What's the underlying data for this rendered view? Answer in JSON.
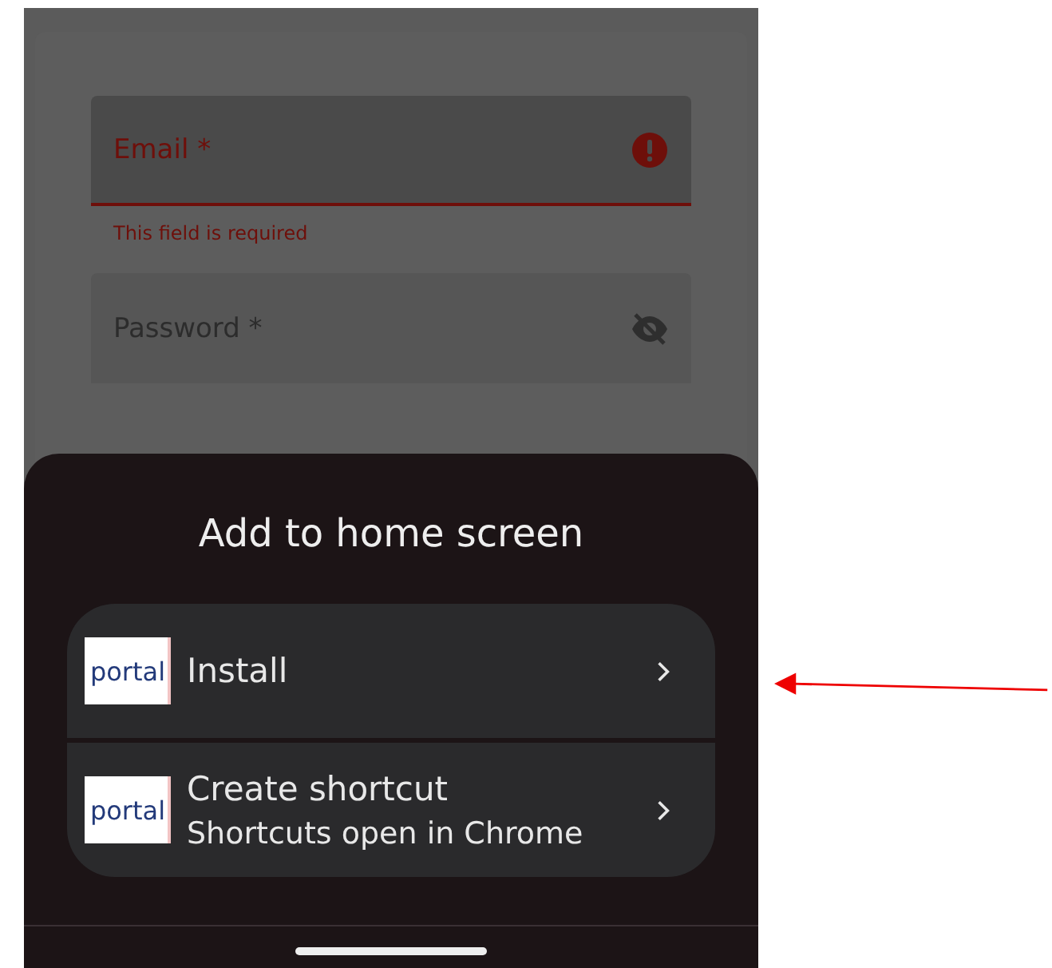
{
  "form": {
    "fields": [
      {
        "label": "Email *",
        "invalid": true,
        "error": "This field is required",
        "kind": "text"
      },
      {
        "label": "Password *",
        "invalid": false,
        "kind": "password"
      }
    ]
  },
  "sheet": {
    "title": "Add to home screen",
    "options": [
      {
        "logo_text": "portal",
        "title": "Install"
      },
      {
        "logo_text": "portal",
        "title": "Create shortcut",
        "subtitle": "Shortcuts open in Chrome"
      }
    ]
  }
}
